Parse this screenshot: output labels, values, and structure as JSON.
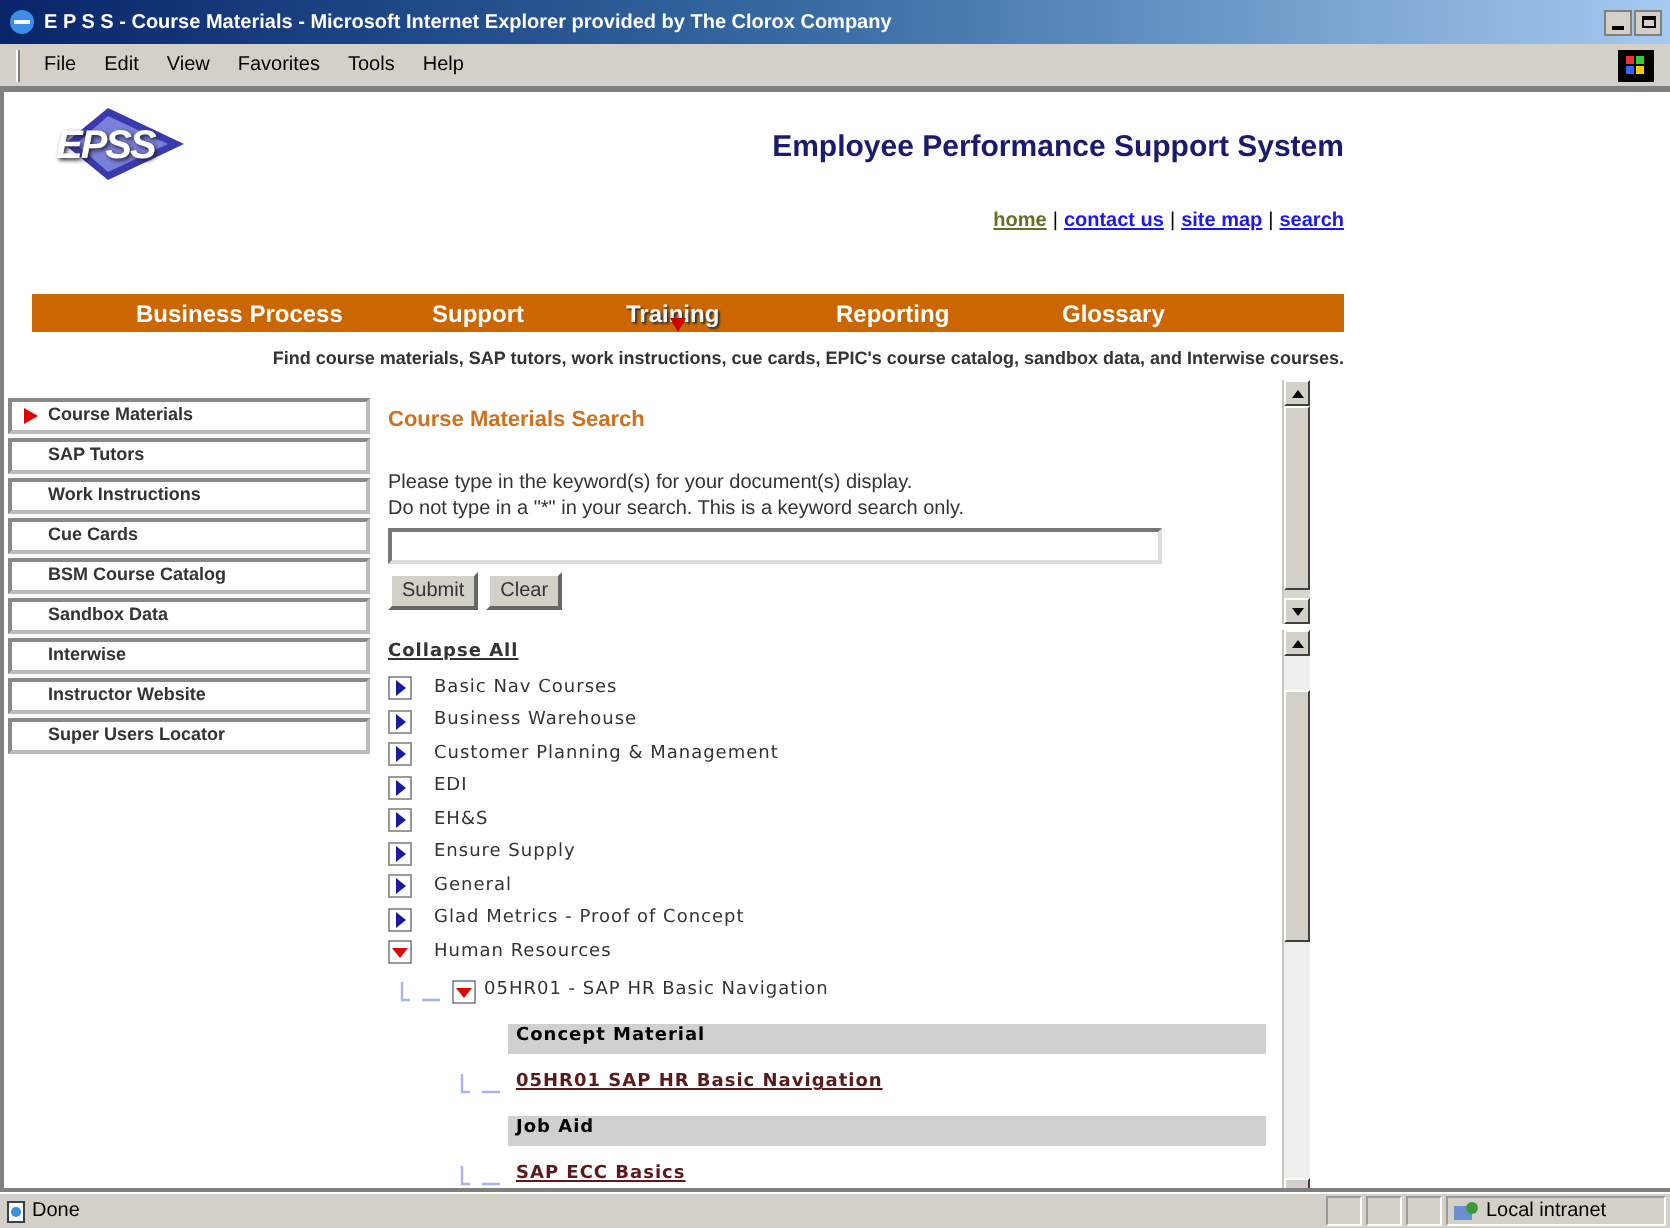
{
  "window": {
    "title": "E P S S - Course Materials - Microsoft Internet Explorer provided by The Clorox Company"
  },
  "menu": [
    "File",
    "Edit",
    "View",
    "Favorites",
    "Tools",
    "Help"
  ],
  "header": {
    "logo": "EPSS",
    "title": "Employee Performance Support System"
  },
  "top_links": [
    {
      "label": "home",
      "visited": true
    },
    {
      "separator": "|",
      "label": "contact us",
      "visited": false
    },
    {
      "separator": "|",
      "label": "site map",
      "visited": false
    },
    {
      "separator": "|",
      "label": "search",
      "visited": false
    }
  ],
  "nav": [
    {
      "label": "Business Process",
      "selected": false
    },
    {
      "label": "Support",
      "selected": false
    },
    {
      "label": "Training",
      "selected": true
    },
    {
      "label": "Reporting",
      "selected": false
    },
    {
      "label": "Glossary",
      "selected": false
    }
  ],
  "tagline": "Find course materials, SAP tutors, work instructions, cue cards, EPIC's course catalog, sandbox data, and Interwise courses.",
  "sidebar": [
    {
      "label": "Course Materials",
      "selected": true
    },
    {
      "label": "SAP Tutors",
      "selected": false
    },
    {
      "label": "Work Instructions",
      "selected": false
    },
    {
      "label": "Cue Cards",
      "selected": false
    },
    {
      "label": "BSM Course Catalog",
      "selected": false
    },
    {
      "label": "Sandbox Data",
      "selected": false
    },
    {
      "label": "Interwise",
      "selected": false
    },
    {
      "label": "Instructor Website",
      "selected": false
    },
    {
      "label": "Super Users Locator",
      "selected": false
    }
  ],
  "search": {
    "heading": "Course Materials Search",
    "instructions": [
      "Please type in the keyword(s) for your document(s) display.",
      "Do not type in a \"*\" in your search. This is a keyword search only."
    ],
    "buttons": [
      "Submit",
      "Clear"
    ]
  },
  "collapse_all": "Collapse All",
  "tree": [
    {
      "label": "Basic Nav Courses",
      "expanded": false
    },
    {
      "label": "Business Warehouse",
      "expanded": false
    },
    {
      "label": "Customer Planning & Management",
      "expanded": false
    },
    {
      "label": "EDI",
      "expanded": false
    },
    {
      "label": "EH&S",
      "expanded": false
    },
    {
      "label": "Ensure Supply",
      "expanded": false
    },
    {
      "label": "General",
      "expanded": false
    },
    {
      "label": "Glad Metrics - Proof of Concept",
      "expanded": false
    },
    {
      "label": "Human Resources",
      "expanded": true,
      "children": [
        {
          "label": "05HR01 - SAP HR Basic Navigation",
          "expanded": true,
          "children": [
            {
              "kind": "section",
              "label": "Concept Material"
            },
            {
              "kind": "link",
              "label": "05HR01 SAP HR Basic Navigation"
            },
            {
              "kind": "section",
              "label": "Job Aid"
            },
            {
              "kind": "link",
              "label": "SAP ECC Basics"
            }
          ]
        }
      ]
    }
  ],
  "status_bar": {
    "text": "Done",
    "zone": "Local intranet"
  }
}
